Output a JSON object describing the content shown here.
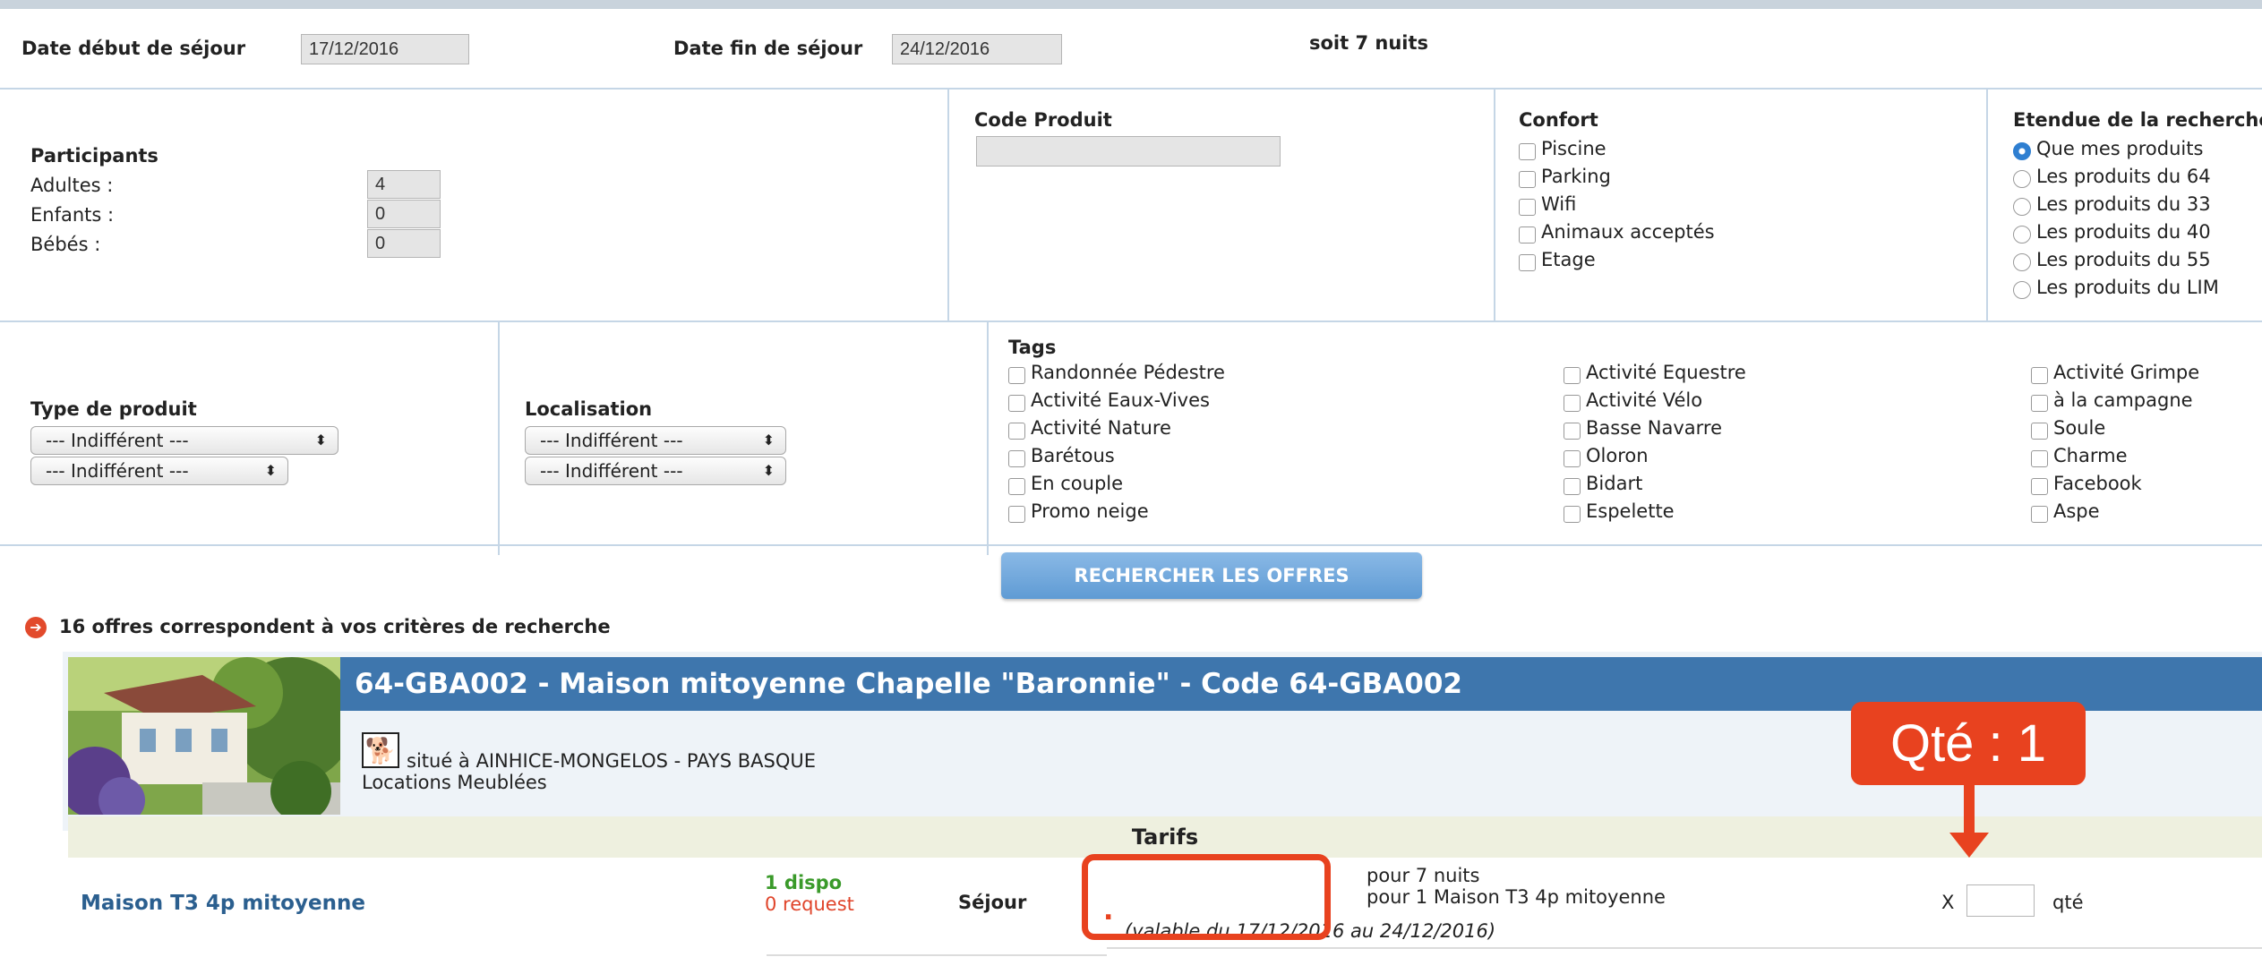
{
  "dates": {
    "start_label": "Date début de séjour",
    "start_value": "17/12/2016",
    "end_label": "Date fin de séjour",
    "end_value": "24/12/2016",
    "nights_text": "soit 7 nuits"
  },
  "participants": {
    "title": "Participants",
    "adults_label": "Adultes :",
    "adults_value": "4",
    "children_label": "Enfants :",
    "children_value": "0",
    "babies_label": "Bébés :",
    "babies_value": "0"
  },
  "code_produit": {
    "label": "Code Produit",
    "value": ""
  },
  "confort": {
    "title": "Confort",
    "options": [
      "Piscine",
      "Parking",
      "Wifi",
      "Animaux acceptés",
      "Etage"
    ]
  },
  "etendue": {
    "title": "Etendue de la recherche",
    "options": [
      "Que mes produits",
      "Les produits du 64",
      "Les produits du 33",
      "Les produits du 40",
      "Les produits du 55",
      "Les produits du LIM"
    ],
    "selected_index": 0
  },
  "type_produit": {
    "label": "Type de produit",
    "select1": "--- Indifférent ---",
    "select2": "--- Indifférent ---"
  },
  "localisation": {
    "label": "Localisation",
    "select1": "--- Indifférent ---",
    "select2": "--- Indifférent ---"
  },
  "tags": {
    "title": "Tags",
    "col1": [
      "Randonnée Pédestre",
      "Activité Eaux-Vives",
      "Activité Nature",
      "Barétous",
      "En couple",
      "Promo neige"
    ],
    "col2": [
      "Activité Equestre",
      "Activité Vélo",
      "Basse Navarre",
      "Oloron",
      "Bidart",
      "Espelette"
    ],
    "col3": [
      "Activité Grimpe",
      "à la campagne",
      "Soule",
      "Charme",
      "Facebook",
      "Aspe"
    ]
  },
  "search_button": "RECHERCHER LES OFFRES",
  "results_text": "16 offres correspondent à vos critères de recherche",
  "listing": {
    "title": "64-GBA002 - Maison mitoyenne Chapelle \"Baronnie\" - Code 64-GBA002",
    "location": "situé à AINHICE-MONGELOS - PAYS BASQUE",
    "category": "Locations Meublées",
    "tarifs_label": "Tarifs",
    "product_name": "Maison T3 4p mitoyenne",
    "dispo": "1 dispo",
    "request": "0 request",
    "sejour_label": "Séjour",
    "price_value": ".",
    "line1": "pour 7 nuits",
    "line2": "pour 1 Maison T3 4p mitoyenne",
    "line3": "(valable du 17/12/2016 au 24/12/2016)",
    "qty_prefix": "X",
    "qty_value": "",
    "qty_suffix": "qté"
  },
  "annotation": {
    "callout": "Qté : 1"
  },
  "colors": {
    "banner": "#3e76ad",
    "accent_red": "#e8421f",
    "dispo_green": "#3a9a2a",
    "request_red": "#e0442a",
    "link_blue": "#2b5f8f"
  }
}
